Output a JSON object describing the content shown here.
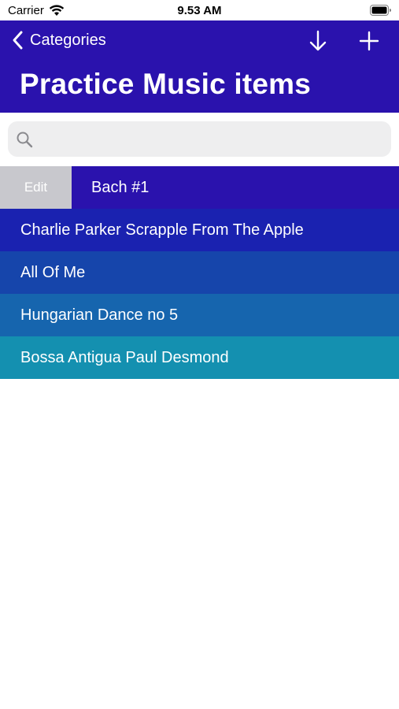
{
  "status": {
    "carrier": "Carrier",
    "time": "9.53 AM"
  },
  "nav": {
    "back_label": "Categories",
    "title": "Practice Music items"
  },
  "search": {
    "placeholder": "",
    "value": ""
  },
  "list": {
    "edit_label": "Edit",
    "items": [
      {
        "label": "Bach #1",
        "color": "#2a12ad"
      },
      {
        "label": "Charlie Parker Scrapple From The Apple",
        "color": "#1a22b0"
      },
      {
        "label": "All Of Me",
        "color": "#1645ab"
      },
      {
        "label": "Hungarian Dance no 5",
        "color": "#1665ae"
      },
      {
        "label": "Bossa Antigua Paul Desmond",
        "color": "#1490b0"
      }
    ]
  },
  "colors": {
    "nav_background": "#2a12ad",
    "edit_action": "#c8c8cd",
    "search_field": "#eeeeef"
  }
}
